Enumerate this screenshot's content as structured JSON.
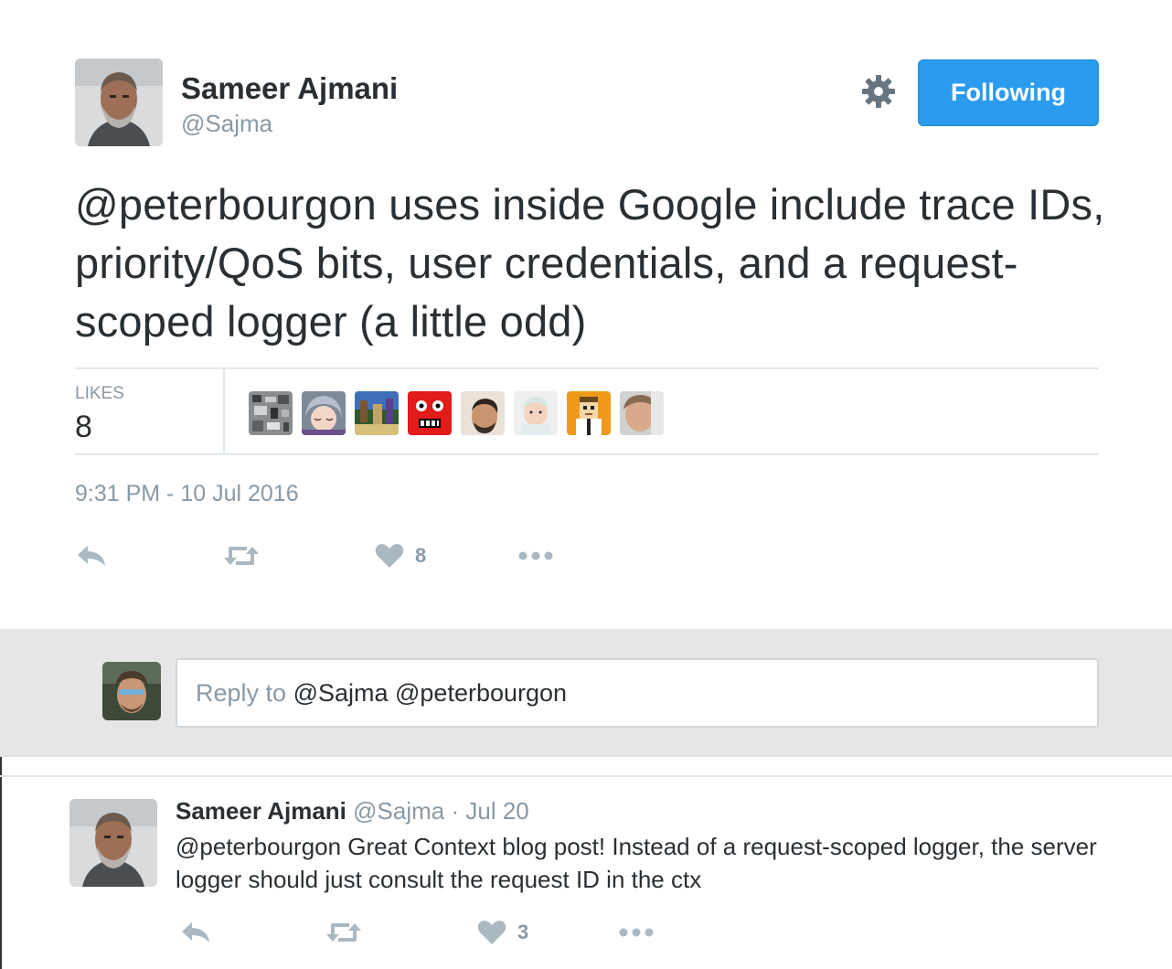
{
  "tweet": {
    "author_name": "Sameer Ajmani",
    "author_handle": "@Sajma",
    "follow_label": "Following",
    "text_mention": "@peterbourgon",
    "text_body": " uses inside Google include trace IDs, priority/QoS bits, user credentials, and a request-scoped logger (a little odd)",
    "likes_label": "LIKES",
    "likes_count": "8",
    "timestamp": "9:31 PM - 10 Jul 2016",
    "like_action_count": "8"
  },
  "reply_box": {
    "placeholder": "Reply to ",
    "handles": "@Sajma @peterbourgon"
  },
  "reply": {
    "author_name": "Sameer Ajmani",
    "author_handle": "@Sajma",
    "separator": "·",
    "date": "Jul 20",
    "text": "@peterbourgon Great Context blog post! Instead of a request-scoped logger, the server logger should just consult the request ID in the ctx",
    "like_action_count": "3"
  },
  "icons": {
    "reply": "reply-icon",
    "retweet": "retweet-icon",
    "like": "heart-icon",
    "more": "more-icon",
    "settings": "gear-icon"
  },
  "colors": {
    "accent": "#2b9bed",
    "muted": "#8899a6",
    "text": "#292f33"
  }
}
